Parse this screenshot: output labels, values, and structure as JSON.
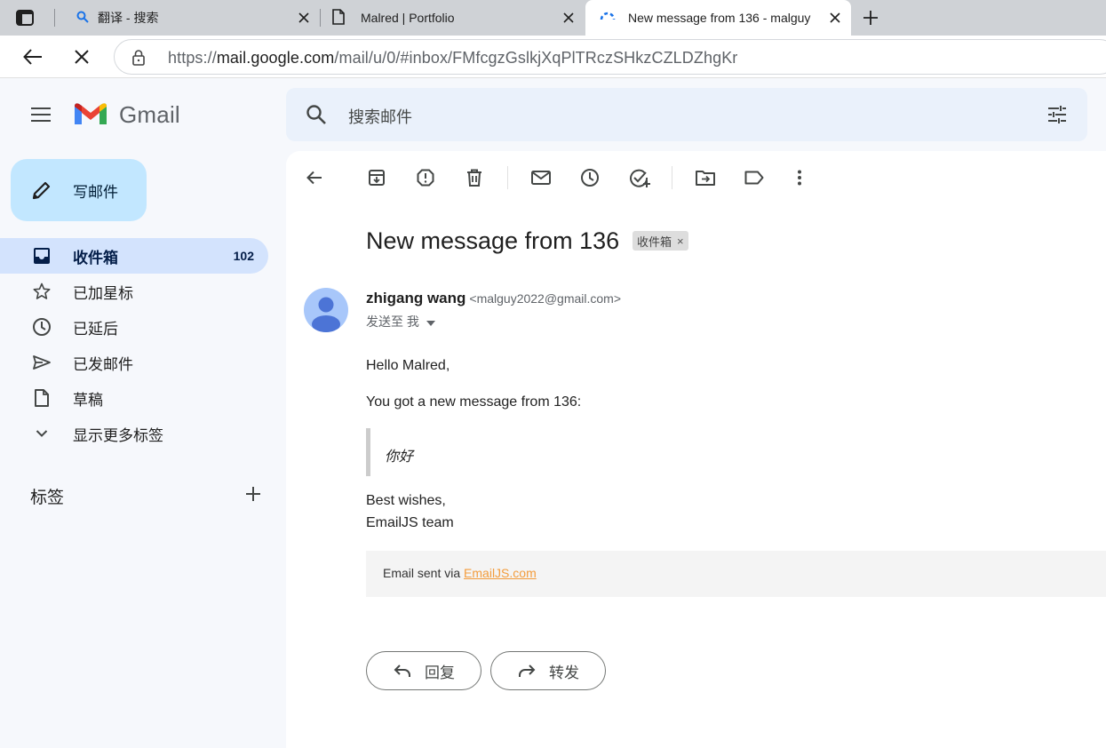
{
  "browser": {
    "tabs": [
      {
        "title": "翻译 - 搜索",
        "icon": "search-icon"
      },
      {
        "title": "Malred | Portfolio",
        "icon": "page-icon"
      },
      {
        "title": "New message from 136 - malguy",
        "icon": "loading-icon"
      }
    ],
    "address": {
      "scheme": "https://",
      "host": "mail.google.com",
      "path": "/mail/u/0/#inbox/FMfcgzGslkjXqPlTRczSHkzCZLDZhgKr"
    }
  },
  "gmail": {
    "logo_text": "Gmail",
    "search_placeholder": "搜索邮件",
    "compose_label": "写邮件",
    "nav": [
      {
        "label": "收件箱",
        "count": "102",
        "icon": "inbox-icon",
        "active": true
      },
      {
        "label": "已加星标",
        "count": "",
        "icon": "star-icon",
        "active": false
      },
      {
        "label": "已延后",
        "count": "",
        "icon": "clock-icon",
        "active": false
      },
      {
        "label": "已发邮件",
        "count": "",
        "icon": "send-icon",
        "active": false
      },
      {
        "label": "草稿",
        "count": "",
        "icon": "draft-icon",
        "active": false
      },
      {
        "label": "显示更多标签",
        "count": "",
        "icon": "chevron-down-icon",
        "active": false
      }
    ],
    "labels_heading": "标签"
  },
  "message": {
    "subject": "New message from 136",
    "chip": "收件箱",
    "sender_name": "zhigang wang",
    "sender_email": "<malguy2022@gmail.com>",
    "recipient": "发送至 我",
    "greeting": "Hello Malred,",
    "intro": "You got a new message from 136:",
    "quote": "你好",
    "closing_1": "Best wishes,",
    "closing_2": "EmailJS team",
    "footer_prefix": "Email sent via ",
    "footer_link": "EmailJS.com",
    "reply_label": "回复",
    "forward_label": "转发"
  },
  "colors": {
    "accent_blue": "#0b57d0",
    "active_nav": "#d3e3fd",
    "compose_bg": "#c2e7ff",
    "link_orange": "#f39c3c"
  }
}
